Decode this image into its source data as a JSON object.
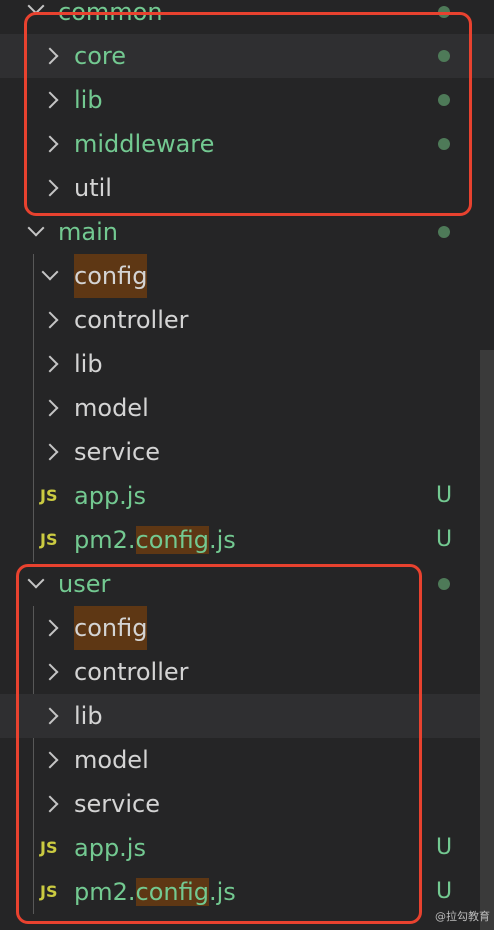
{
  "tree": {
    "common": {
      "label": "common"
    },
    "common_children": [
      {
        "label": "core",
        "color": "green",
        "dot": true,
        "hover": true
      },
      {
        "label": "lib",
        "color": "green",
        "dot": true
      },
      {
        "label": "middleware",
        "color": "green",
        "dot": true
      },
      {
        "label": "util",
        "color": "white",
        "dot": false
      }
    ],
    "main": {
      "label": "main"
    },
    "main_children": {
      "config": "config",
      "controller": "controller",
      "lib": "lib",
      "model": "model",
      "service": "service",
      "app_js": "app.js",
      "app_js_status": "U",
      "pm2_prefix": "pm2.",
      "pm2_highlight": "config",
      "pm2_suffix": ".js",
      "pm2_status": "U"
    },
    "user": {
      "label": "user"
    },
    "user_children": {
      "config": "config",
      "controller": "controller",
      "lib": "lib",
      "model": "model",
      "service": "service",
      "app_js": "app.js",
      "app_js_status": "U",
      "pm2_prefix": "pm2.",
      "pm2_highlight": "config",
      "pm2_suffix": ".js",
      "pm2_status": "U"
    },
    "js_icon_text": "JS"
  },
  "watermark": "@拉勾教育",
  "colors": {
    "background": "#252526",
    "untracked_green": "#73c991",
    "highlight_brown": "#5e3714",
    "annotation_red": "#e8422f",
    "js_yellow": "#cbcb41"
  }
}
